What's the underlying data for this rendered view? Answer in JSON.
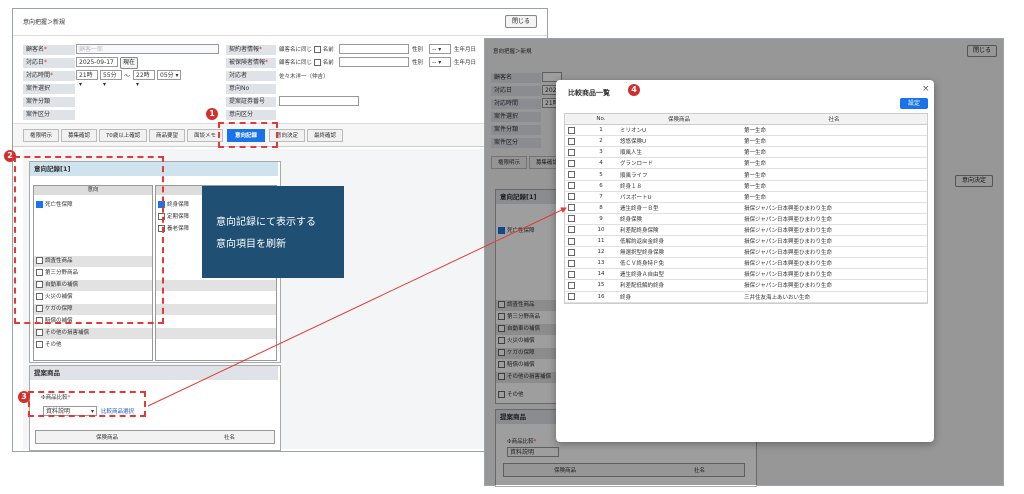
{
  "left": {
    "breadcrumb": "意向把握＞新規",
    "close_label": "閉じる",
    "fields": {
      "customer_name_label": "顧客名",
      "customer_name_placeholder": "顧客一郎",
      "contact_date_label": "対応日",
      "contact_date_value": "2025-09-17",
      "today_button": "現在",
      "contact_time_label": "対応時間",
      "time_from_hour": "21時",
      "time_from_min": "55分",
      "time_tilde": "～",
      "time_to_hour": "22時",
      "time_to_min": "05分",
      "case_select_label": "案件選択",
      "case_class_label": "案件分類",
      "case_type_label": "案件区分",
      "contractor_label": "契約者情報",
      "insured_label": "被保険者情報",
      "same_as_customer": "顧客名に同じ",
      "name_label": "名前",
      "gender_label": "性別",
      "gender_value": "--",
      "birth_label": "生年月日",
      "handler_label": "対応者",
      "handler_value": "佐々木洋一（仲吉）",
      "intent_no_label": "意向No",
      "proposal_no_label": "提案証券番号",
      "intent_type_label": "意向区分"
    },
    "tabs": [
      "権限明示",
      "募集確認",
      "70歳以上確認",
      "商品要望",
      "面談メモ",
      "意向記録",
      "意向決定",
      "最終確認"
    ],
    "active_tab": "意向記録",
    "intent_section_title": "意向記録[1]",
    "intent_col_header": "意向",
    "intent_items": [
      "死亡性保障",
      "調査性商品",
      "第三分野商品",
      "自動車の補償",
      "火災の補償",
      "ケガの保障",
      "賠償の補償",
      "その他の損害補償",
      "その他"
    ],
    "checked_item": "死亡性保障",
    "right_col_items": [
      "終身保障",
      "定期保障",
      "養老保障"
    ],
    "proposal_section_title": "提案商品",
    "product_compare_label": "商品比較",
    "product_compare_value": "資料説明",
    "compare_select_link": "比較商品選択",
    "bottom_table_headers": [
      "保険商品",
      "社名"
    ]
  },
  "annotation": {
    "line1": "意向記録にて表示する",
    "line2": "意向項目を刷新"
  },
  "markers": [
    "1",
    "2",
    "3",
    "4"
  ],
  "right": {
    "breadcrumb": "意向把握＞新規",
    "close_label": "閉じる",
    "decision_button": "意向決定",
    "intent_section_title": "意向記録[1]",
    "intent_items": [
      "死亡性保障",
      "調査性商品",
      "第三分野商品",
      "自動車の補償",
      "火災の補償",
      "ケガの保障",
      "賠償の補償",
      "その他の損害補償",
      "その他"
    ],
    "proposal_section_title": "提案商品",
    "product_compare_label": "商品比較",
    "product_compare_value": "資料説明",
    "bottom_table_headers": [
      "保険商品",
      "社名"
    ],
    "bg_labels": [
      "顧客名",
      "対応日",
      "対応時間",
      "案件選択",
      "案件分類",
      "案件区分"
    ],
    "bg_date": "2025-",
    "bg_hour": "21時",
    "bg_tabs": [
      "権限明示",
      "募集確認"
    ]
  },
  "modal": {
    "title": "比較商品一覧",
    "close_glyph": "×",
    "confirm_button": "設定",
    "headers": [
      "No.",
      "保険商品",
      "社名"
    ],
    "rows": [
      {
        "no": "1",
        "product": "ミリオンU",
        "company": "第一生命"
      },
      {
        "no": "2",
        "product": "悠悠保険U",
        "company": "第一生命"
      },
      {
        "no": "3",
        "product": "順風人生",
        "company": "第一生命"
      },
      {
        "no": "4",
        "product": "グランロード",
        "company": "第一生命"
      },
      {
        "no": "5",
        "product": "順風ライフ",
        "company": "第一生命"
      },
      {
        "no": "6",
        "product": "終身１８",
        "company": "第一生命"
      },
      {
        "no": "7",
        "product": "パスポートU",
        "company": "第一生命"
      },
      {
        "no": "8",
        "product": "逓生終身－Ｂ型",
        "company": "損保ジャパン日本興亜ひまわり生命"
      },
      {
        "no": "9",
        "product": "終身保険",
        "company": "損保ジャパン日本興亜ひまわり生命"
      },
      {
        "no": "10",
        "product": "利差配終身保険",
        "company": "損保ジャパン日本興亜ひまわり生命"
      },
      {
        "no": "11",
        "product": "低解約返戻金終身",
        "company": "損保ジャパン日本興亜ひまわり生命"
      },
      {
        "no": "12",
        "product": "無選択型終身保険",
        "company": "損保ジャパン日本興亜ひまわり生命"
      },
      {
        "no": "13",
        "product": "低ＣＶ終身特Ｐ免",
        "company": "損保ジャパン日本興亜ひまわり生命"
      },
      {
        "no": "14",
        "product": "逓生終身Ａ自由型",
        "company": "損保ジャパン日本興亜ひまわり生命"
      },
      {
        "no": "15",
        "product": "利差配低解約終身",
        "company": "損保ジャパン日本興亜ひまわり生命"
      },
      {
        "no": "16",
        "product": "終身",
        "company": "三井住友海上あいおい生命"
      }
    ]
  },
  "colors": {
    "accent": "#1a73e8",
    "annotation_bg": "#1f4f73",
    "dash": "#e53935"
  }
}
